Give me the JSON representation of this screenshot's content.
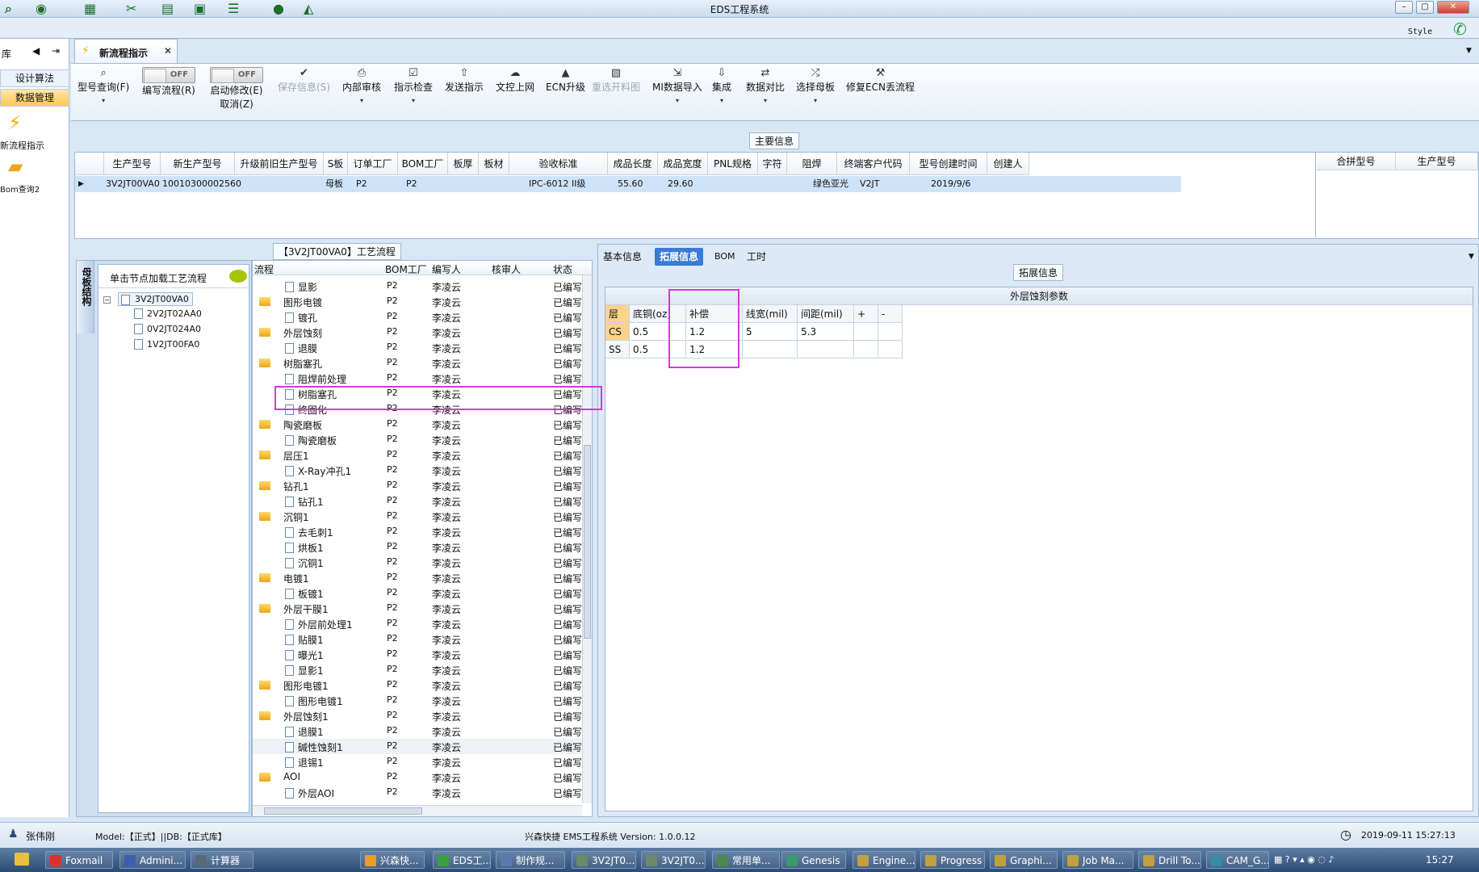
{
  "window": {
    "title": "EDS工程系统",
    "style_label": "Style"
  },
  "left_nav": {
    "top_label": "库",
    "tabs": [
      "设计算法",
      "数据管理"
    ],
    "items": [
      {
        "label": "新流程指示",
        "icon": "lightning-icon"
      },
      {
        "label": "Bom查询2",
        "icon": "folder-icon"
      }
    ]
  },
  "doc_tab": {
    "label": "新流程指示"
  },
  "ribbon": {
    "buttons": [
      {
        "label": "型号查询(F)",
        "icon": "search-icon"
      },
      {
        "label": "编写流程(R)",
        "icon": "toggle",
        "state": "OFF"
      },
      {
        "label": "启动修改(E)",
        "sub": "取消(Z)",
        "icon": "toggle",
        "state": "OFF"
      },
      {
        "label": "保存信息(S)",
        "icon": "check-icon",
        "disabled": true
      },
      {
        "label": "内部审核",
        "icon": "print-icon"
      },
      {
        "label": "指示检查",
        "icon": "checklist-icon"
      },
      {
        "label": "发送指示",
        "icon": "upload-icon"
      },
      {
        "label": "文控上网",
        "icon": "cloud-upload-icon"
      },
      {
        "label": "ECN升级",
        "icon": "ecn-icon"
      },
      {
        "label": "重选开料图",
        "icon": "image-icon",
        "disabled": true
      },
      {
        "label": "MI数据导入",
        "icon": "import-icon"
      },
      {
        "label": "集成",
        "icon": "download-icon"
      },
      {
        "label": "数据对比",
        "icon": "compare-icon"
      },
      {
        "label": "选择母板",
        "icon": "shuffle-icon"
      },
      {
        "label": "修复ECN丢流程",
        "icon": "wrench-icon"
      }
    ]
  },
  "main_info": {
    "title": "主要信息",
    "headers": [
      "生产型号",
      "新生产型号",
      "升级前旧生产型号",
      "S板",
      "订单工厂",
      "BOM工厂",
      "板厚",
      "板材",
      "验收标准",
      "成品长度",
      "成品宽度",
      "PNL规格",
      "字符",
      "阻焊",
      "终端客户代码",
      "型号创建时间",
      "创建人"
    ],
    "row": [
      "3V2JT00VA0",
      "10010300002560",
      "",
      "母板",
      "P2",
      "P2",
      "",
      "",
      "IPC-6012 II级",
      "55.60",
      "29.60",
      "",
      "",
      "绿色亚光",
      "V2JT",
      "2019/9/6",
      ""
    ],
    "side_headers": [
      "合拼型号",
      "生产型号"
    ]
  },
  "process": {
    "title": "【3V2JT00VA0】工艺流程",
    "hint": "单击节点加载工艺流程",
    "side_label": "母板结构",
    "tree_root": "3V2JT00VA0",
    "tree_children": [
      "2V2JT02AA0",
      "0V2JT024A0",
      "1V2JT00FA0"
    ],
    "headers": [
      "流程",
      "BOM工厂",
      "编写人",
      "核审人",
      "状态"
    ],
    "rows": [
      {
        "name": "显影",
        "level": 2,
        "bom": "P2",
        "author": "李凌云",
        "status": "已编写"
      },
      {
        "name": "图形电镀",
        "level": 1,
        "bom": "P2",
        "author": "李凌云",
        "status": "已编写"
      },
      {
        "name": "镀孔",
        "level": 2,
        "bom": "P2",
        "author": "李凌云",
        "status": "已编写"
      },
      {
        "name": "外层蚀刻",
        "level": 1,
        "bom": "P2",
        "author": "李凌云",
        "status": "已编写"
      },
      {
        "name": "退膜",
        "level": 2,
        "bom": "P2",
        "author": "李凌云",
        "status": "已编写"
      },
      {
        "name": "树脂塞孔",
        "level": 1,
        "bom": "P2",
        "author": "李凌云",
        "status": "已编写"
      },
      {
        "name": "阻焊前处理",
        "level": 2,
        "bom": "P2",
        "author": "李凌云",
        "status": "已编写"
      },
      {
        "name": "树脂塞孔",
        "level": 2,
        "bom": "P2",
        "author": "李凌云",
        "status": "已编写"
      },
      {
        "name": "终固化",
        "level": 2,
        "bom": "P2",
        "author": "李凌云",
        "status": "已编写"
      },
      {
        "name": "陶瓷磨板",
        "level": 1,
        "bom": "P2",
        "author": "李凌云",
        "status": "已编写"
      },
      {
        "name": "陶瓷磨板",
        "level": 2,
        "bom": "P2",
        "author": "李凌云",
        "status": "已编写"
      },
      {
        "name": "层压1",
        "level": 1,
        "bom": "P2",
        "author": "李凌云",
        "status": "已编写"
      },
      {
        "name": "X-Ray冲孔1",
        "level": 2,
        "bom": "P2",
        "author": "李凌云",
        "status": "已编写"
      },
      {
        "name": "钻孔1",
        "level": 1,
        "bom": "P2",
        "author": "李凌云",
        "status": "已编写"
      },
      {
        "name": "钻孔1",
        "level": 2,
        "bom": "P2",
        "author": "李凌云",
        "status": "已编写"
      },
      {
        "name": "沉铜1",
        "level": 1,
        "bom": "P2",
        "author": "李凌云",
        "status": "已编写"
      },
      {
        "name": "去毛刺1",
        "level": 2,
        "bom": "P2",
        "author": "李凌云",
        "status": "已编写"
      },
      {
        "name": "烘板1",
        "level": 2,
        "bom": "P2",
        "author": "李凌云",
        "status": "已编写"
      },
      {
        "name": "沉铜1",
        "level": 2,
        "bom": "P2",
        "author": "李凌云",
        "status": "已编写"
      },
      {
        "name": "电镀1",
        "level": 1,
        "bom": "P2",
        "author": "李凌云",
        "status": "已编写"
      },
      {
        "name": "板镀1",
        "level": 2,
        "bom": "P2",
        "author": "李凌云",
        "status": "已编写"
      },
      {
        "name": "外层干膜1",
        "level": 1,
        "bom": "P2",
        "author": "李凌云",
        "status": "已编写"
      },
      {
        "name": "外层前处理1",
        "level": 2,
        "bom": "P2",
        "author": "李凌云",
        "status": "已编写"
      },
      {
        "name": "贴膜1",
        "level": 2,
        "bom": "P2",
        "author": "李凌云",
        "status": "已编写"
      },
      {
        "name": "曝光1",
        "level": 2,
        "bom": "P2",
        "author": "李凌云",
        "status": "已编写"
      },
      {
        "name": "显影1",
        "level": 2,
        "bom": "P2",
        "author": "李凌云",
        "status": "已编写"
      },
      {
        "name": "图形电镀1",
        "level": 1,
        "bom": "P2",
        "author": "李凌云",
        "status": "已编写"
      },
      {
        "name": "图形电镀1",
        "level": 2,
        "bom": "P2",
        "author": "李凌云",
        "status": "已编写"
      },
      {
        "name": "外层蚀刻1",
        "level": 1,
        "bom": "P2",
        "author": "李凌云",
        "status": "已编写"
      },
      {
        "name": "退膜1",
        "level": 2,
        "bom": "P2",
        "author": "李凌云",
        "status": "已编写"
      },
      {
        "name": "碱性蚀刻1",
        "level": 2,
        "bom": "P2",
        "author": "李凌云",
        "status": "已编写"
      },
      {
        "name": "退锡1",
        "level": 2,
        "bom": "P2",
        "author": "李凌云",
        "status": "已编写"
      },
      {
        "name": "AOI",
        "level": 1,
        "bom": "P2",
        "author": "李凌云",
        "status": "已编写"
      },
      {
        "name": "外层AOI",
        "level": 2,
        "bom": "P2",
        "author": "李凌云",
        "status": "已编写"
      }
    ]
  },
  "right": {
    "tabs": [
      "基本信息",
      "拓展信息",
      "BOM",
      "工时"
    ],
    "active_tab": "拓展信息",
    "section": "拓展信息",
    "grid_title": "外层蚀刻参数",
    "headers": [
      "层",
      "底铜(oz)",
      "补偿",
      "线宽(mil)",
      "间距(mil)",
      "+",
      "-"
    ],
    "rows": [
      [
        "CS",
        "0.5",
        "1.2",
        "5",
        "5.3",
        "",
        ""
      ],
      [
        "SS",
        "0.5",
        "1.2",
        "",
        "",
        "",
        ""
      ]
    ]
  },
  "status": {
    "user": "张伟刚",
    "model": "Model:【正式】||DB:【正式库】",
    "app": "兴森快捷 EMS工程系统 Version: 1.0.0.12",
    "datetime": "2019-09-11 15:27:13"
  },
  "taskbar": {
    "items": [
      "Foxmail",
      "Admini...",
      "计算器",
      "兴森快...",
      "EDS工...",
      "制作规...",
      "3V2JT0...",
      "3V2JT0...",
      "常用单...",
      "Genesis",
      "Engine...",
      "Progress",
      "Graphi...",
      "Job Ma...",
      "Drill To...",
      "CAM_G..."
    ],
    "clock": "15:27"
  }
}
